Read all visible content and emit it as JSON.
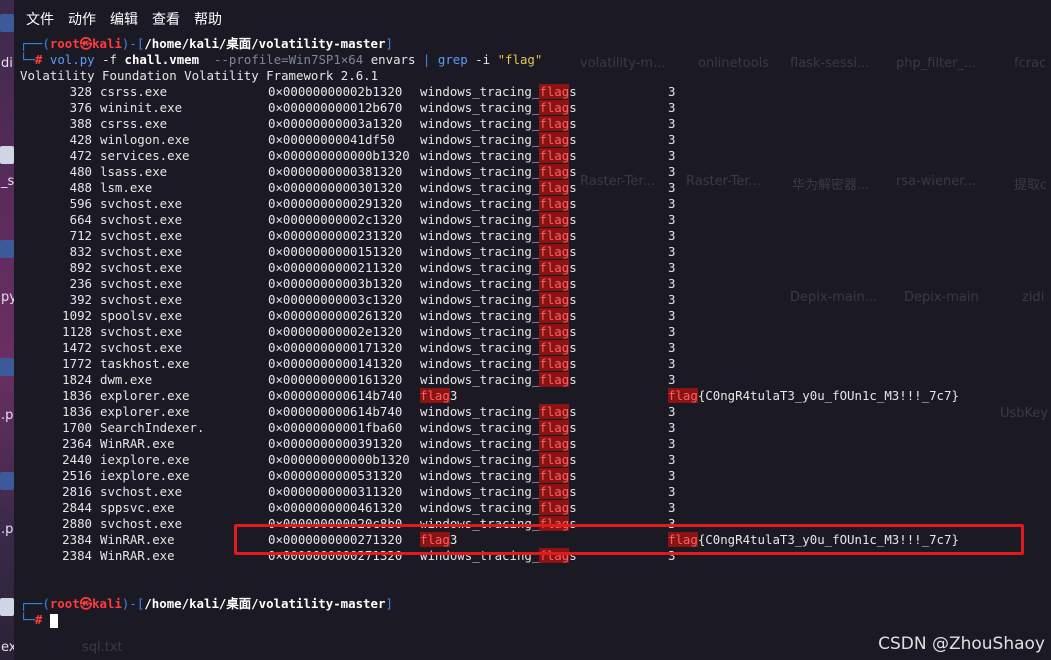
{
  "menu": [
    "文件",
    "动作",
    "编辑",
    "查看",
    "帮助"
  ],
  "desktop_left_labels": [
    "din",
    "_study",
    "py",
    ".p",
    ".p",
    "ext"
  ],
  "desktop_ghost_labels": [
    "volatility-m...",
    "onlinetools",
    "flask-sessi...",
    "php_filter_...",
    "fcrac",
    "Raster-Ter...",
    "Raster-Ter...",
    "华为解密器...",
    "rsa-wiener...",
    "提取c",
    "Depix-main...",
    "Depix-main",
    "zidi",
    "UsbKey",
    "sql.txt"
  ],
  "prompt": {
    "user": "root",
    "at": "㉿",
    "host": "kali",
    "path": "/home/kali/桌面/volatility-master",
    "hash": "#"
  },
  "command": {
    "prog": "vol.py",
    "flag_f": "-f",
    "file": "chall.vmem",
    "profile": "--profile=Win7SP1×64",
    "plugin": "envars",
    "pipe": "|",
    "grep": "grep",
    "grep_opt": "-i",
    "pattern": "\"flag\""
  },
  "banner": "Volatility Foundation Volatility Framework 2.6.1",
  "rows": [
    {
      "pid": "328",
      "proc": "csrss.exe",
      "addr": "0×00000000002b1320",
      "var_pre": "windows_tracing_",
      "var_hl": "flag",
      "var_post": "s",
      "val_hl": "",
      "val": "3"
    },
    {
      "pid": "376",
      "proc": "wininit.exe",
      "addr": "0×000000000012b670",
      "var_pre": "windows_tracing_",
      "var_hl": "flag",
      "var_post": "s",
      "val_hl": "",
      "val": "3"
    },
    {
      "pid": "388",
      "proc": "csrss.exe",
      "addr": "0×00000000003a1320",
      "var_pre": "windows_tracing_",
      "var_hl": "flag",
      "var_post": "s",
      "val_hl": "",
      "val": "3"
    },
    {
      "pid": "428",
      "proc": "winlogon.exe",
      "addr": "0×00000000041df50",
      "var_pre": "windows_tracing_",
      "var_hl": "flag",
      "var_post": "s",
      "val_hl": "",
      "val": "3"
    },
    {
      "pid": "472",
      "proc": "services.exe",
      "addr": "0×000000000000b1320",
      "var_pre": "windows_tracing_",
      "var_hl": "flag",
      "var_post": "s",
      "val_hl": "",
      "val": "3"
    },
    {
      "pid": "480",
      "proc": "lsass.exe",
      "addr": "0×0000000000381320",
      "var_pre": "windows_tracing_",
      "var_hl": "flag",
      "var_post": "s",
      "val_hl": "",
      "val": "3"
    },
    {
      "pid": "488",
      "proc": "lsm.exe",
      "addr": "0×0000000000301320",
      "var_pre": "windows_tracing_",
      "var_hl": "flag",
      "var_post": "s",
      "val_hl": "",
      "val": "3"
    },
    {
      "pid": "596",
      "proc": "svchost.exe",
      "addr": "0×0000000000291320",
      "var_pre": "windows_tracing_",
      "var_hl": "flag",
      "var_post": "s",
      "val_hl": "",
      "val": "3"
    },
    {
      "pid": "664",
      "proc": "svchost.exe",
      "addr": "0×00000000002c1320",
      "var_pre": "windows_tracing_",
      "var_hl": "flag",
      "var_post": "s",
      "val_hl": "",
      "val": "3"
    },
    {
      "pid": "712",
      "proc": "svchost.exe",
      "addr": "0×0000000000231320",
      "var_pre": "windows_tracing_",
      "var_hl": "flag",
      "var_post": "s",
      "val_hl": "",
      "val": "3"
    },
    {
      "pid": "832",
      "proc": "svchost.exe",
      "addr": "0×0000000000151320",
      "var_pre": "windows_tracing_",
      "var_hl": "flag",
      "var_post": "s",
      "val_hl": "",
      "val": "3"
    },
    {
      "pid": "892",
      "proc": "svchost.exe",
      "addr": "0×0000000000211320",
      "var_pre": "windows_tracing_",
      "var_hl": "flag",
      "var_post": "s",
      "val_hl": "",
      "val": "3"
    },
    {
      "pid": "236",
      "proc": "svchost.exe",
      "addr": "0×00000000003b1320",
      "var_pre": "windows_tracing_",
      "var_hl": "flag",
      "var_post": "s",
      "val_hl": "",
      "val": "3"
    },
    {
      "pid": "392",
      "proc": "svchost.exe",
      "addr": "0×00000000003c1320",
      "var_pre": "windows_tracing_",
      "var_hl": "flag",
      "var_post": "s",
      "val_hl": "",
      "val": "3"
    },
    {
      "pid": "1092",
      "proc": "spoolsv.exe",
      "addr": "0×0000000000261320",
      "var_pre": "windows_tracing_",
      "var_hl": "flag",
      "var_post": "s",
      "val_hl": "",
      "val": "3"
    },
    {
      "pid": "1128",
      "proc": "svchost.exe",
      "addr": "0×00000000002e1320",
      "var_pre": "windows_tracing_",
      "var_hl": "flag",
      "var_post": "s",
      "val_hl": "",
      "val": "3"
    },
    {
      "pid": "1472",
      "proc": "svchost.exe",
      "addr": "0×0000000000171320",
      "var_pre": "windows_tracing_",
      "var_hl": "flag",
      "var_post": "s",
      "val_hl": "",
      "val": "3"
    },
    {
      "pid": "1772",
      "proc": "taskhost.exe",
      "addr": "0×0000000000141320",
      "var_pre": "windows_tracing_",
      "var_hl": "flag",
      "var_post": "s",
      "val_hl": "",
      "val": "3"
    },
    {
      "pid": "1824",
      "proc": "dwm.exe",
      "addr": "0×0000000000161320",
      "var_pre": "windows_tracing_",
      "var_hl": "flag",
      "var_post": "s",
      "val_hl": "",
      "val": "3"
    },
    {
      "pid": "1836",
      "proc": "explorer.exe",
      "addr": "0×000000000614b740",
      "var_pre": "",
      "var_hl": "flag",
      "var_post": "3",
      "val_hl": "flag",
      "val": "{C0ngR4tulaT3_y0u_fOUn1c_M3!!!_7c7}"
    },
    {
      "pid": "1836",
      "proc": "explorer.exe",
      "addr": "0×000000000614b740",
      "var_pre": "windows_tracing_",
      "var_hl": "flag",
      "var_post": "s",
      "val_hl": "",
      "val": "3"
    },
    {
      "pid": "1700",
      "proc": "SearchIndexer.",
      "addr": "0×00000000001fba60",
      "var_pre": "windows_tracing_",
      "var_hl": "flag",
      "var_post": "s",
      "val_hl": "",
      "val": "3"
    },
    {
      "pid": "2364",
      "proc": "WinRAR.exe",
      "addr": "0×0000000000391320",
      "var_pre": "windows_tracing_",
      "var_hl": "flag",
      "var_post": "s",
      "val_hl": "",
      "val": "3"
    },
    {
      "pid": "2440",
      "proc": "iexplore.exe",
      "addr": "0×000000000000b1320",
      "var_pre": "windows_tracing_",
      "var_hl": "flag",
      "var_post": "s",
      "val_hl": "",
      "val": "3"
    },
    {
      "pid": "2516",
      "proc": "iexplore.exe",
      "addr": "0×0000000000531320",
      "var_pre": "windows_tracing_",
      "var_hl": "flag",
      "var_post": "s",
      "val_hl": "",
      "val": "3"
    },
    {
      "pid": "2816",
      "proc": "svchost.exe",
      "addr": "0×0000000000311320",
      "var_pre": "windows_tracing_",
      "var_hl": "flag",
      "var_post": "s",
      "val_hl": "",
      "val": "3"
    },
    {
      "pid": "2844",
      "proc": "sppsvc.exe",
      "addr": "0×0000000000461320",
      "var_pre": "windows_tracing_",
      "var_hl": "flag",
      "var_post": "s",
      "val_hl": "",
      "val": "3"
    },
    {
      "pid": "2880",
      "proc": "svchost.exe",
      "addr": "0×000000000020c8b0",
      "var_pre": "windows_tracing_",
      "var_hl": "flag",
      "var_post": "s",
      "val_hl": "",
      "val": "3"
    },
    {
      "pid": "2384",
      "proc": "WinRAR.exe",
      "addr": "0×0000000000271320",
      "var_pre": "",
      "var_hl": "flag",
      "var_post": "3",
      "val_hl": "flag",
      "val": "{C0ngR4tulaT3_y0u_fOUn1c_M3!!!_7c7}"
    },
    {
      "pid": "2384",
      "proc": "WinRAR.exe",
      "addr": "0×0000000000271320",
      "var_pre": "windows_tracing_",
      "var_hl": "flag",
      "var_post": "s",
      "val_hl": "",
      "val": "3"
    }
  ],
  "watermark": "CSDN @ZhouShaoy"
}
